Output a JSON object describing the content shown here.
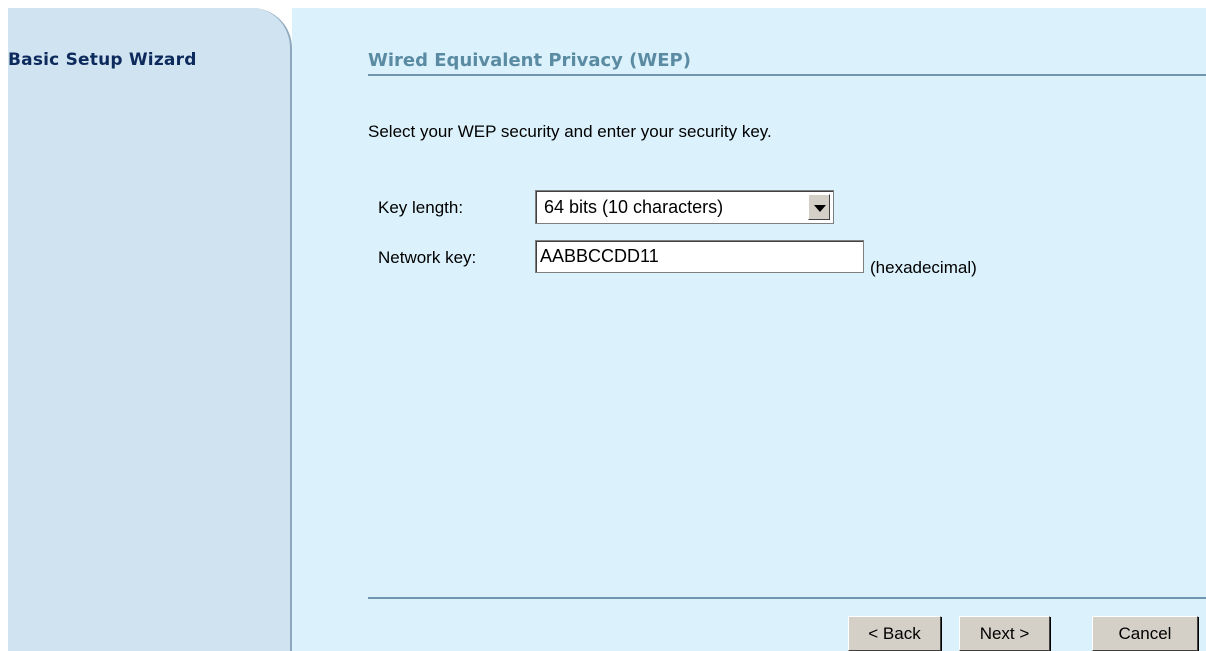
{
  "sidebar": {
    "title": "Basic Setup Wizard"
  },
  "main": {
    "title": "Wired Equivalent Privacy (WEP)",
    "instructions": "Select your WEP security and enter your security key.",
    "key_length": {
      "label": "Key length:",
      "selected": "64 bits (10 characters)"
    },
    "network_key": {
      "label": "Network key:",
      "value": "AABBCCDD11",
      "hint": "(hexadecimal)"
    }
  },
  "buttons": {
    "back": "< Back",
    "next": "Next >",
    "cancel": "Cancel"
  },
  "colors": {
    "sidebar_bg": "#d0e3f0",
    "content_bg": "#dbf1fb",
    "sidebar_title": "#0d2a5c",
    "page_title": "#5a8ba3",
    "rule": "#7095b0",
    "button_face": "#d4d0c8"
  },
  "icons": {
    "dropdown": "chevron-down-icon"
  }
}
